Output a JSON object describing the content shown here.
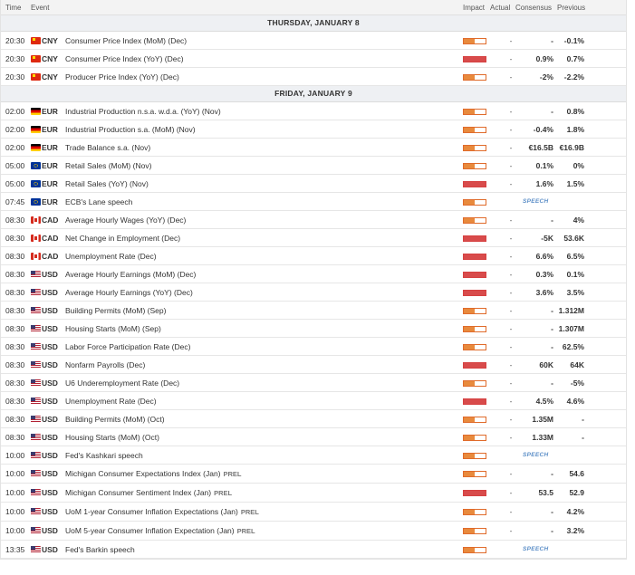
{
  "header": {
    "time": "Time",
    "event": "Event",
    "impact": "Impact",
    "actual": "Actual",
    "consensus": "Consensus",
    "previous": "Previous"
  },
  "colors": {
    "impact_high": "#d84b4b",
    "impact_medium": "#e88a3d",
    "speech": "#5b8ec7"
  },
  "rows": [
    {
      "type": "day",
      "label": "THURSDAY, JANUARY 8"
    },
    {
      "type": "event",
      "time": "20:30",
      "flag": "CNY",
      "currency": "CNY",
      "event": "Consumer Price Index (MoM) (Dec)",
      "impact": "medium",
      "actual": "-",
      "consensus": "-",
      "previous": "-0.1%"
    },
    {
      "type": "event",
      "time": "20:30",
      "flag": "CNY",
      "currency": "CNY",
      "event": "Consumer Price Index (YoY) (Dec)",
      "impact": "high",
      "actual": "-",
      "consensus": "0.9%",
      "previous": "0.7%"
    },
    {
      "type": "event",
      "time": "20:30",
      "flag": "CNY",
      "currency": "CNY",
      "event": "Producer Price Index (YoY) (Dec)",
      "impact": "medium",
      "actual": "-",
      "consensus": "-2%",
      "previous": "-2.2%"
    },
    {
      "type": "day",
      "label": "FRIDAY, JANUARY 9"
    },
    {
      "type": "event",
      "time": "02:00",
      "flag": "DE",
      "currency": "EUR",
      "event": "Industrial Production n.s.a. w.d.a. (YoY) (Nov)",
      "impact": "medium",
      "actual": "-",
      "consensus": "-",
      "previous": "0.8%"
    },
    {
      "type": "event",
      "time": "02:00",
      "flag": "DE",
      "currency": "EUR",
      "event": "Industrial Production s.a. (MoM) (Nov)",
      "impact": "medium",
      "actual": "-",
      "consensus": "-0.4%",
      "previous": "1.8%"
    },
    {
      "type": "event",
      "time": "02:00",
      "flag": "DE",
      "currency": "EUR",
      "event": "Trade Balance s.a. (Nov)",
      "impact": "medium",
      "actual": "-",
      "consensus": "€16.5B",
      "previous": "€16.9B"
    },
    {
      "type": "event",
      "time": "05:00",
      "flag": "EUR",
      "currency": "EUR",
      "event": "Retail Sales (MoM) (Nov)",
      "impact": "medium",
      "actual": "-",
      "consensus": "0.1%",
      "previous": "0%"
    },
    {
      "type": "event",
      "time": "05:00",
      "flag": "EUR",
      "currency": "EUR",
      "event": "Retail Sales (YoY) (Nov)",
      "impact": "high",
      "actual": "-",
      "consensus": "1.6%",
      "previous": "1.5%"
    },
    {
      "type": "event",
      "time": "07:45",
      "flag": "EUR",
      "currency": "EUR",
      "event": "ECB's Lane speech",
      "impact": "medium",
      "actual": "",
      "speech": "SPEECH"
    },
    {
      "type": "event",
      "time": "08:30",
      "flag": "CAD",
      "currency": "CAD",
      "event": "Average Hourly Wages (YoY) (Dec)",
      "impact": "medium",
      "actual": "-",
      "consensus": "-",
      "previous": "4%"
    },
    {
      "type": "event",
      "time": "08:30",
      "flag": "CAD",
      "currency": "CAD",
      "event": "Net Change in Employment (Dec)",
      "impact": "high",
      "actual": "-",
      "consensus": "-5K",
      "previous": "53.6K"
    },
    {
      "type": "event",
      "time": "08:30",
      "flag": "CAD",
      "currency": "CAD",
      "event": "Unemployment Rate (Dec)",
      "impact": "high",
      "actual": "-",
      "consensus": "6.6%",
      "previous": "6.5%"
    },
    {
      "type": "event",
      "time": "08:30",
      "flag": "USD",
      "currency": "USD",
      "event": "Average Hourly Earnings (MoM) (Dec)",
      "impact": "high",
      "actual": "-",
      "consensus": "0.3%",
      "previous": "0.1%"
    },
    {
      "type": "event",
      "time": "08:30",
      "flag": "USD",
      "currency": "USD",
      "event": "Average Hourly Earnings (YoY) (Dec)",
      "impact": "high",
      "actual": "-",
      "consensus": "3.6%",
      "previous": "3.5%"
    },
    {
      "type": "event",
      "time": "08:30",
      "flag": "USD",
      "currency": "USD",
      "event": "Building Permits (MoM) (Sep)",
      "impact": "medium",
      "actual": "-",
      "consensus": "-",
      "previous": "1.312M"
    },
    {
      "type": "event",
      "time": "08:30",
      "flag": "USD",
      "currency": "USD",
      "event": "Housing Starts (MoM) (Sep)",
      "impact": "medium",
      "actual": "-",
      "consensus": "-",
      "previous": "1.307M"
    },
    {
      "type": "event",
      "time": "08:30",
      "flag": "USD",
      "currency": "USD",
      "event": "Labor Force Participation Rate (Dec)",
      "impact": "medium",
      "actual": "-",
      "consensus": "-",
      "previous": "62.5%"
    },
    {
      "type": "event",
      "time": "08:30",
      "flag": "USD",
      "currency": "USD",
      "event": "Nonfarm Payrolls (Dec)",
      "impact": "high",
      "actual": "-",
      "consensus": "60K",
      "previous": "64K"
    },
    {
      "type": "event",
      "time": "08:30",
      "flag": "USD",
      "currency": "USD",
      "event": "U6 Underemployment Rate (Dec)",
      "impact": "medium",
      "actual": "-",
      "consensus": "-",
      "previous": "-5%"
    },
    {
      "type": "event",
      "time": "08:30",
      "flag": "USD",
      "currency": "USD",
      "event": "Unemployment Rate (Dec)",
      "impact": "high",
      "actual": "-",
      "consensus": "4.5%",
      "previous": "4.6%"
    },
    {
      "type": "event",
      "time": "08:30",
      "flag": "USD",
      "currency": "USD",
      "event": "Building Permits (MoM) (Oct)",
      "impact": "medium",
      "actual": "-",
      "consensus": "1.35M",
      "previous": "-"
    },
    {
      "type": "event",
      "time": "08:30",
      "flag": "USD",
      "currency": "USD",
      "event": "Housing Starts (MoM) (Oct)",
      "impact": "medium",
      "actual": "-",
      "consensus": "1.33M",
      "previous": "-"
    },
    {
      "type": "event",
      "time": "10:00",
      "flag": "USD",
      "currency": "USD",
      "event": "Fed's Kashkari speech",
      "impact": "medium",
      "actual": "",
      "speech": "SPEECH"
    },
    {
      "type": "event",
      "time": "10:00",
      "flag": "USD",
      "currency": "USD",
      "event": "Michigan Consumer Expectations Index (Jan)",
      "prel": "PREL",
      "impact": "medium",
      "actual": "-",
      "consensus": "-",
      "previous": "54.6"
    },
    {
      "type": "event",
      "time": "10:00",
      "flag": "USD",
      "currency": "USD",
      "event": "Michigan Consumer Sentiment Index (Jan)",
      "prel": "PREL",
      "impact": "high",
      "actual": "-",
      "consensus": "53.5",
      "previous": "52.9"
    },
    {
      "type": "event",
      "time": "10:00",
      "flag": "USD",
      "currency": "USD",
      "event": "UoM 1-year Consumer Inflation Expectations (Jan)",
      "prel": "PREL",
      "impact": "medium",
      "actual": "-",
      "consensus": "-",
      "previous": "4.2%"
    },
    {
      "type": "event",
      "time": "10:00",
      "flag": "USD",
      "currency": "USD",
      "event": "UoM 5-year Consumer Inflation Expectation (Jan)",
      "prel": "PREL",
      "impact": "medium",
      "actual": "-",
      "consensus": "-",
      "previous": "3.2%"
    },
    {
      "type": "event",
      "time": "13:35",
      "flag": "USD",
      "currency": "USD",
      "event": "Fed's Barkin speech",
      "impact": "medium",
      "actual": "",
      "speech": "SPEECH"
    }
  ]
}
